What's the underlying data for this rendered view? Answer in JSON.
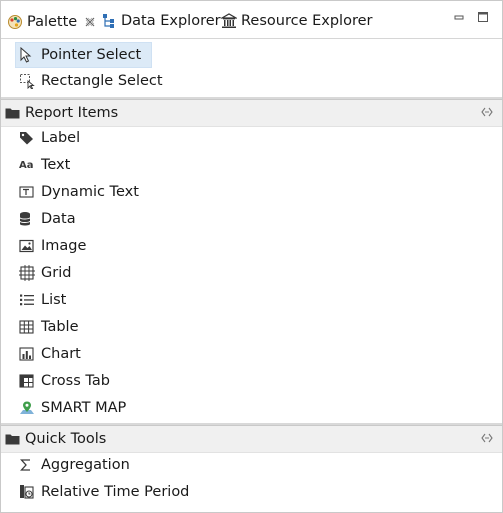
{
  "tabs": [
    {
      "label": "Palette",
      "icon": "palette-icon",
      "active": true,
      "closable": true
    },
    {
      "label": "Data Explorer",
      "icon": "data-explorer-icon",
      "active": false
    },
    {
      "label": "Resource Explorer",
      "icon": "resource-explorer-icon",
      "active": false
    }
  ],
  "window_controls": {
    "minimize": "minimize-icon",
    "maximize": "maximize-icon"
  },
  "selection_tools": [
    {
      "label": "Pointer Select",
      "icon": "pointer-icon",
      "selected": true
    },
    {
      "label": "Rectangle Select",
      "icon": "rectangle-select-icon",
      "selected": false
    }
  ],
  "drawers": {
    "report_items": {
      "label": "Report Items",
      "icon": "folder-icon",
      "items": [
        {
          "label": "Label",
          "icon": "tag-icon"
        },
        {
          "label": "Text",
          "icon": "text-aa-icon"
        },
        {
          "label": "Dynamic Text",
          "icon": "dynamic-text-icon"
        },
        {
          "label": "Data",
          "icon": "database-icon"
        },
        {
          "label": "Image",
          "icon": "image-icon"
        },
        {
          "label": "Grid",
          "icon": "grid-icon"
        },
        {
          "label": "List",
          "icon": "list-icon"
        },
        {
          "label": "Table",
          "icon": "table-icon"
        },
        {
          "label": "Chart",
          "icon": "chart-icon"
        },
        {
          "label": "Cross Tab",
          "icon": "cross-tab-icon"
        },
        {
          "label": "SMART MAP",
          "icon": "map-pin-icon"
        }
      ]
    },
    "quick_tools": {
      "label": "Quick Tools",
      "icon": "folder-icon",
      "items": [
        {
          "label": "Aggregation",
          "icon": "sigma-icon"
        },
        {
          "label": "Relative Time Period",
          "icon": "relative-time-icon"
        }
      ]
    }
  },
  "colors": {
    "selection": "#dceaf7",
    "drawer_bg": "#f0f0f0",
    "border": "#c9c9c9",
    "icon_dark": "#3a3a3a",
    "icon_blue": "#2f6fb5"
  }
}
